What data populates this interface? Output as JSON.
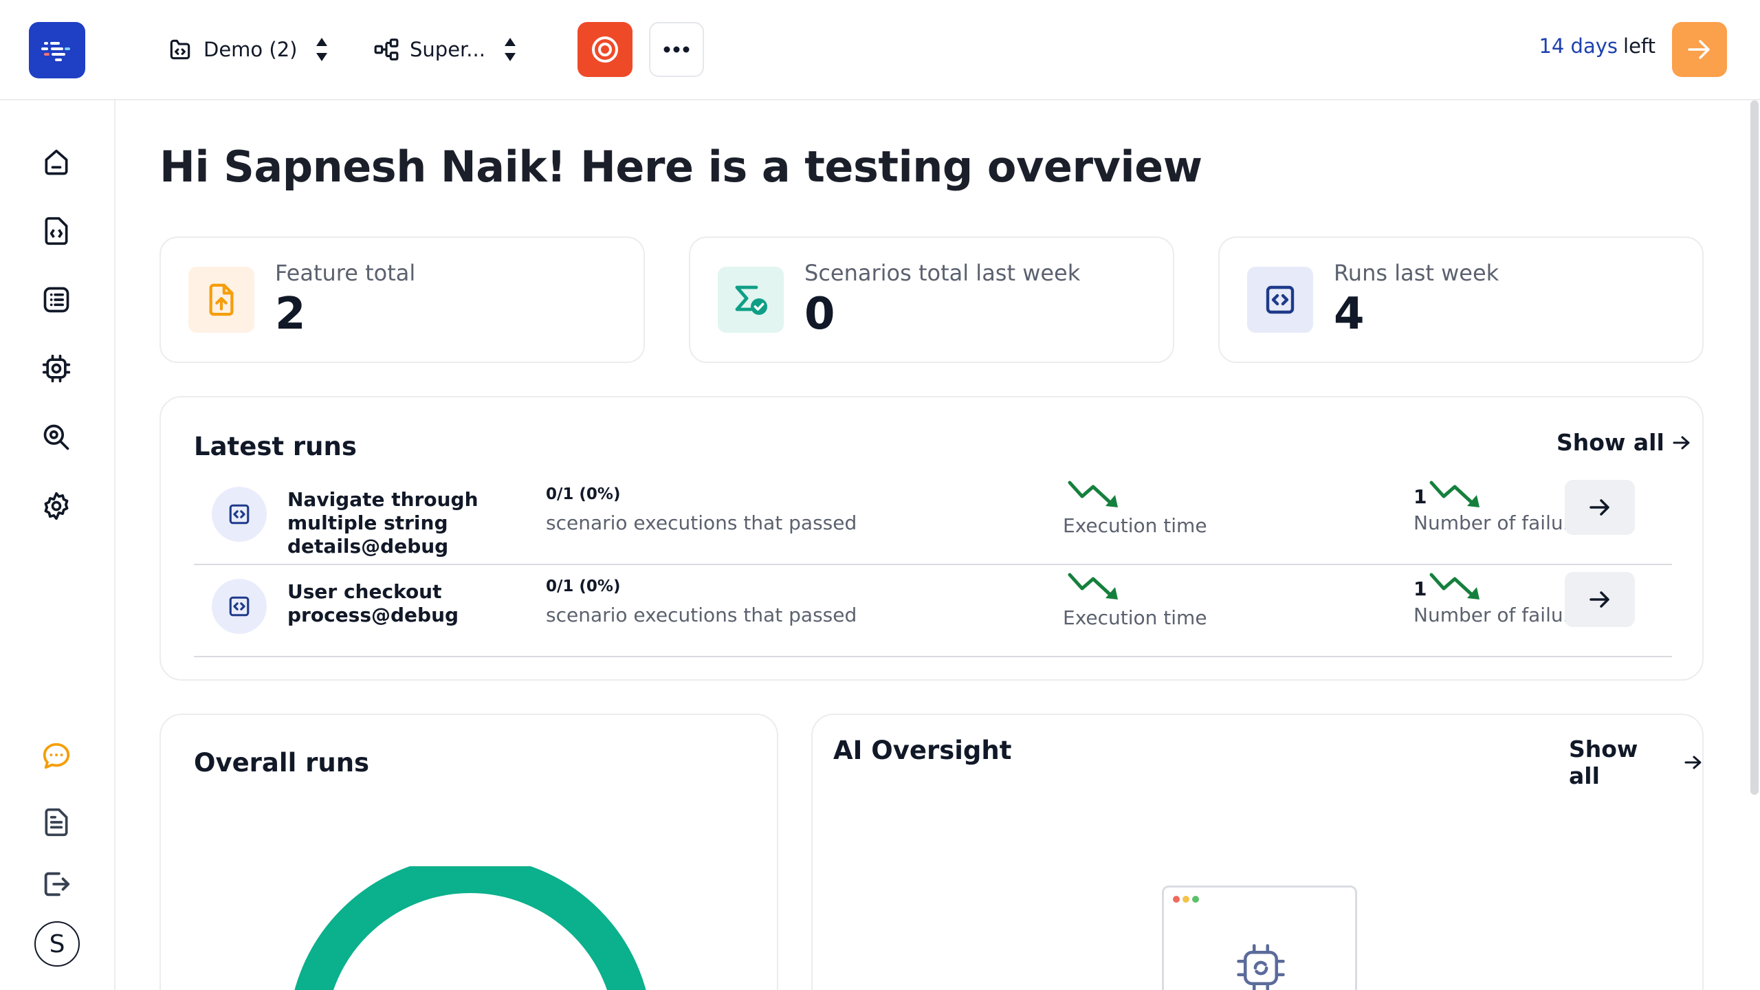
{
  "topbar": {
    "project": {
      "label": "Demo (2)",
      "icon": "project-code-icon"
    },
    "suite": {
      "label": "Super...",
      "icon": "workflow-icon"
    },
    "trial": {
      "days": "14 days",
      "left": "left"
    },
    "colors": {
      "record": "#ee4a28",
      "trial_button": "#fba04b",
      "logo": "#1f3fc4"
    }
  },
  "sidebar": {
    "items": [
      {
        "icon": "home-icon"
      },
      {
        "icon": "code-file-icon"
      },
      {
        "icon": "list-icon"
      },
      {
        "icon": "bug-icon"
      },
      {
        "icon": "search-icon"
      },
      {
        "icon": "settings-icon"
      }
    ],
    "bottom": [
      {
        "icon": "chat-icon"
      },
      {
        "icon": "document-icon"
      },
      {
        "icon": "logout-icon"
      }
    ],
    "avatar_initial": "S"
  },
  "greeting": "Hi Sapnesh Naik! Here is a testing overview",
  "stats": [
    {
      "label": "Feature total",
      "value": "2",
      "icon": "feature-upload-icon"
    },
    {
      "label": "Scenarios total last week",
      "value": "0",
      "icon": "sigma-check-icon"
    },
    {
      "label": "Runs last week",
      "value": "4",
      "icon": "code-window-icon"
    }
  ],
  "latest_runs": {
    "title": "Latest runs",
    "show_all": "Show all",
    "rows": [
      {
        "name": "Navigate through multiple string details@debug",
        "ratio": "0/1 (0%)",
        "passed_label": "scenario executions that passed",
        "exec_label": "Execution time",
        "failures": "1",
        "failures_label": "Number of failures"
      },
      {
        "name": "User checkout process@debug",
        "ratio": "0/1 (0%)",
        "passed_label": "scenario executions that passed",
        "exec_label": "Execution time",
        "failures": "1",
        "failures_label": "Number of failures"
      }
    ]
  },
  "overall_runs": {
    "title": "Overall runs",
    "donut_color": "#0bb08c"
  },
  "ai_oversight": {
    "title": "AI Oversight",
    "show_all": "Show all"
  }
}
